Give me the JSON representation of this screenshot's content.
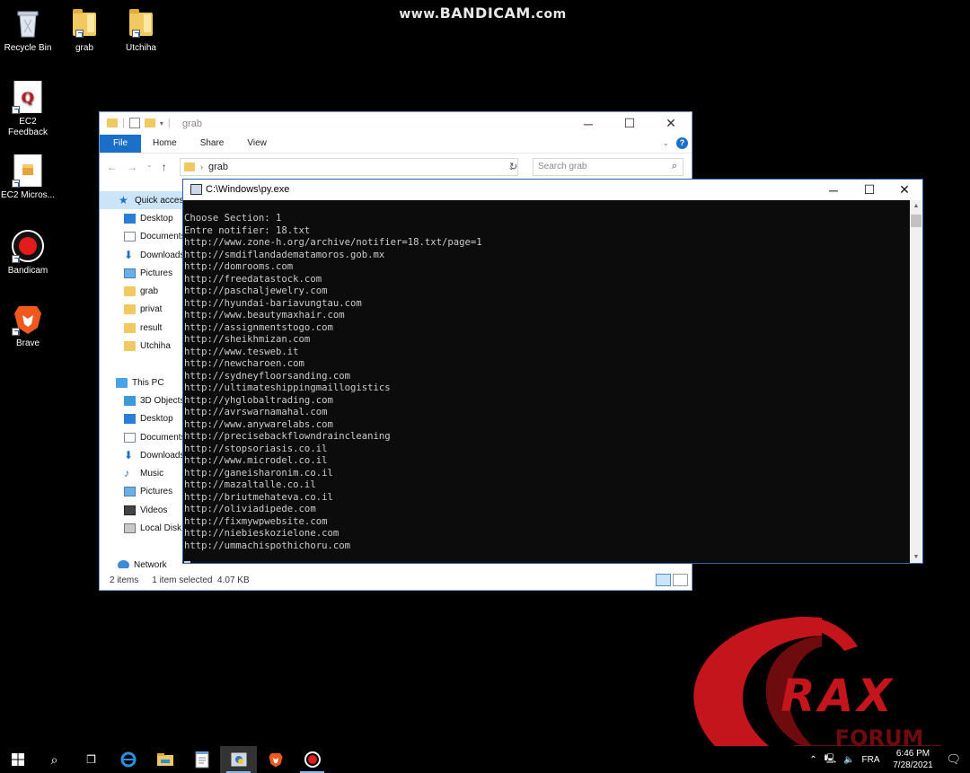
{
  "watermark": {
    "prefix": "www.",
    "brand": "BANDICAM",
    "suffix": ".com"
  },
  "desktop": {
    "icons": [
      {
        "label": "Recycle Bin"
      },
      {
        "label": "grab"
      },
      {
        "label": "Utchiha"
      },
      {
        "label": "EC2 Feedback"
      },
      {
        "label": "EC2 Micros..."
      },
      {
        "label": "Bandicam"
      },
      {
        "label": "Brave"
      }
    ]
  },
  "explorer": {
    "title": "grab",
    "tabs": [
      "File",
      "Home",
      "Share",
      "View"
    ],
    "address": "grab",
    "search_placeholder": "Search grab",
    "nav_items": [
      {
        "label": "Quick access",
        "icon": "star-icon"
      },
      {
        "label": "Desktop",
        "icon": "desktop-icon"
      },
      {
        "label": "Documents",
        "icon": "documents-icon"
      },
      {
        "label": "Downloads",
        "icon": "downloads-icon"
      },
      {
        "label": "Pictures",
        "icon": "pictures-icon"
      },
      {
        "label": "grab",
        "icon": "folder-icon"
      },
      {
        "label": "privat",
        "icon": "folder-icon"
      },
      {
        "label": "result",
        "icon": "folder-icon"
      },
      {
        "label": "Utchiha",
        "icon": "folder-icon"
      },
      {
        "label": "",
        "icon": ""
      },
      {
        "label": "This PC",
        "icon": "pc-icon"
      },
      {
        "label": "3D Objects",
        "icon": "3d-objects-icon"
      },
      {
        "label": "Desktop",
        "icon": "desktop-icon"
      },
      {
        "label": "Documents",
        "icon": "documents-icon"
      },
      {
        "label": "Downloads",
        "icon": "downloads-icon"
      },
      {
        "label": "Music",
        "icon": "music-icon"
      },
      {
        "label": "Pictures",
        "icon": "pictures-icon"
      },
      {
        "label": "Videos",
        "icon": "videos-icon"
      },
      {
        "label": "Local Disk",
        "icon": "disk-icon"
      },
      {
        "label": "",
        "icon": ""
      },
      {
        "label": "Network",
        "icon": "network-icon"
      }
    ],
    "status": {
      "items": "2 items",
      "selected": "1 item selected  4.07 KB"
    }
  },
  "console": {
    "title": "C:\\Windows\\py.exe",
    "lines": [
      "Choose Section: 1",
      "Entre notifier: 18.txt",
      "http://www.zone-h.org/archive/notifier=18.txt/page=1",
      "http://smdiflandadematamoros.gob.mx",
      "http://domrooms.com",
      "http://freedatastock.com",
      "http://paschaljewelry.com",
      "http://hyundai-bariavungtau.com",
      "http://www.beautymaxhair.com",
      "http://assignmentstogo.com",
      "http://sheikhmizan.com",
      "http://www.tesweb.it",
      "http://newcharoen.com",
      "http://sydneyfloorsanding.com",
      "http://ultimateshippingmaillogistics",
      "http://yhglobaltrading.com",
      "http://avrswarnamahal.com",
      "http://www.anywarelabs.com",
      "http://precisebackflowndraincleaning",
      "http://stopsoriasis.co.il",
      "http://www.microdel.co.il",
      "http://ganeisharonim.co.il",
      "http://mazaltalle.co.il",
      "http://briutmehateva.co.il",
      "http://oliviadipede.com",
      "http://fixmywpwebsite.com",
      "http://niebieskozielone.com",
      "http://ummachispothichoru.com"
    ]
  },
  "logo": {
    "text": "RAX",
    "forum": "FORUM",
    "colors": {
      "red": "#c4151c",
      "dark_red": "#6d0b0e"
    }
  },
  "taskbar": {
    "lang": "FRA",
    "time": "6:46 PM",
    "date": "7/28/2021"
  }
}
